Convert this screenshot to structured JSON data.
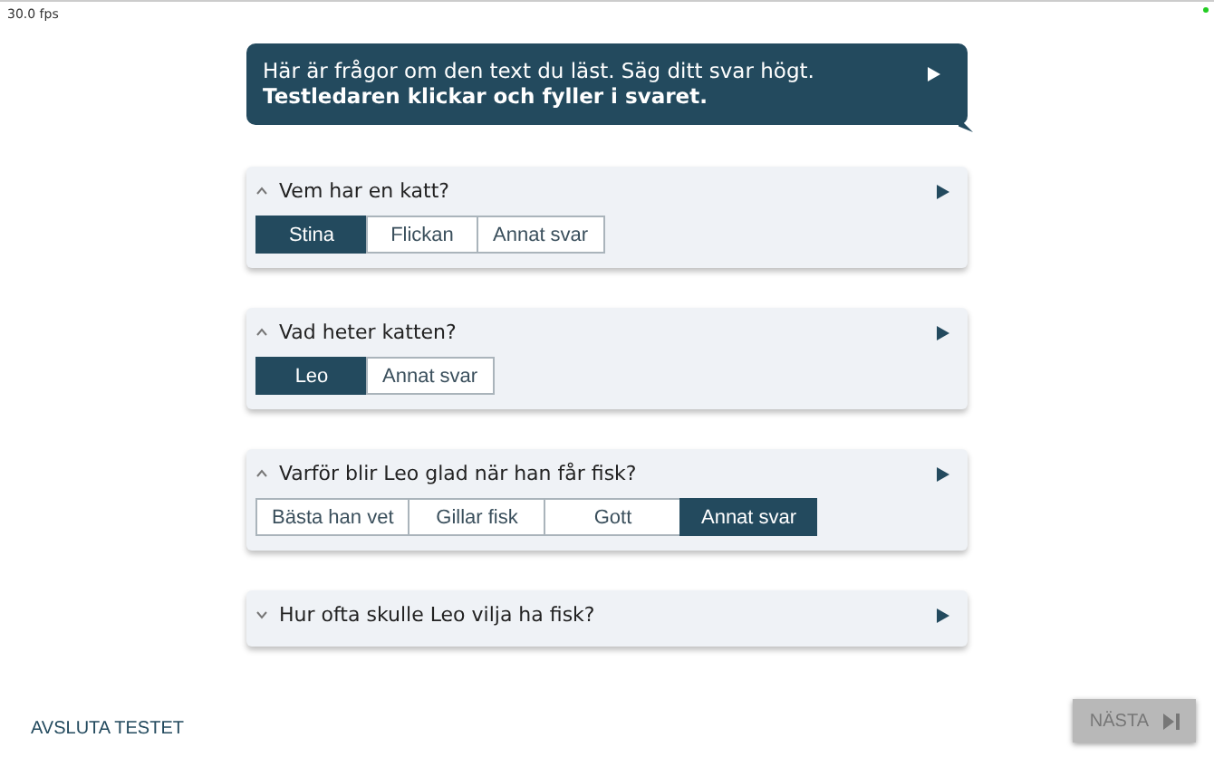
{
  "fps": "30.0 fps",
  "intro": {
    "line_1": "Här är frågor om den text du läst. Säg ditt svar högt.",
    "line_2": "Testledaren klickar och fyller i svaret."
  },
  "questions": [
    {
      "question": "Vem har en katt?",
      "expanded": true,
      "options": [
        {
          "label": "Stina",
          "selected": true
        },
        {
          "label": "Flickan",
          "selected": false
        },
        {
          "label": "Annat svar",
          "selected": false
        }
      ]
    },
    {
      "question": "Vad heter katten?",
      "expanded": true,
      "options": [
        {
          "label": "Leo",
          "selected": true
        },
        {
          "label": "Annat svar",
          "selected": false
        }
      ]
    },
    {
      "question": "Varför blir Leo glad när han får fisk?",
      "expanded": true,
      "options": [
        {
          "label": "Bästa han vet",
          "selected": false
        },
        {
          "label": "Gillar fisk",
          "selected": false
        },
        {
          "label": "Gott",
          "selected": false
        },
        {
          "label": "Annat svar",
          "selected": true
        }
      ]
    },
    {
      "question": "Hur ofta skulle Leo vilja ha fisk?",
      "expanded": false
    }
  ],
  "footer": {
    "quit_link": "AVSLUTA TESTET",
    "next_button": {
      "label": "NÄSTA",
      "disabled": true
    }
  }
}
